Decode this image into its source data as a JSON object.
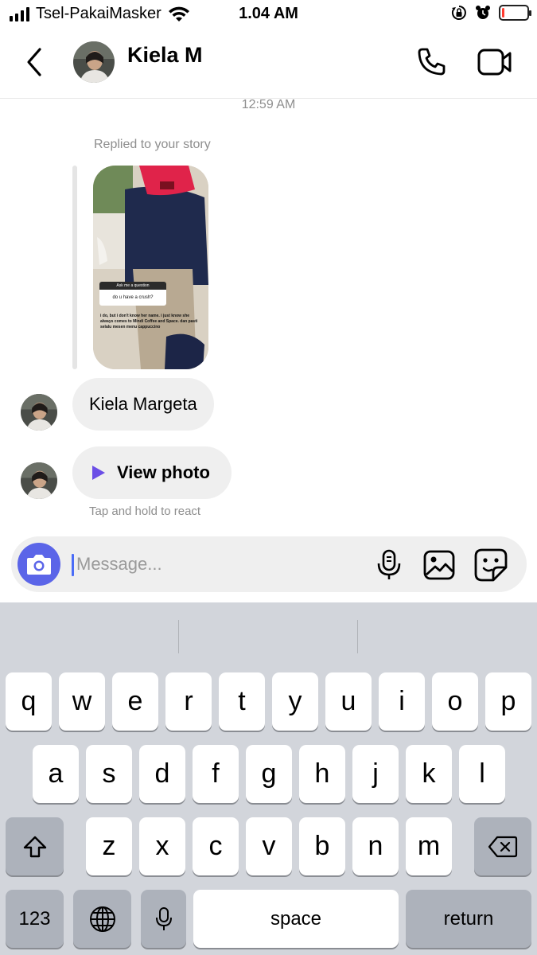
{
  "status_bar": {
    "carrier": "Tsel-PakaiMasker",
    "time": "1.04 AM",
    "battery_level": 0.1,
    "icons": [
      "signal-icon",
      "wifi-icon",
      "orientation-lock-icon",
      "alarm-icon",
      "battery-icon"
    ]
  },
  "header": {
    "contact_name": "Kiela M",
    "icons": [
      "back-chevron-icon",
      "phone-icon",
      "video-camera-icon"
    ]
  },
  "chat": {
    "timestamp": "12:59 AM",
    "replied_label": "Replied to your story",
    "story": {
      "sticker_title": "Ask me a question",
      "sticker_question": "do u have a crush?",
      "answer_text": "i do, but i don't know her name. i just know she always comes to Mindi Coffee and Space. dan pasti selalu mesen menu cappuccino",
      "cap_brand": "mason"
    },
    "messages": [
      {
        "type": "text",
        "text": "Kiela Margeta"
      },
      {
        "type": "photo",
        "text": "View photo"
      }
    ],
    "tap_hint": "Tap and hold to react"
  },
  "composer": {
    "placeholder": "Message...",
    "value": "",
    "icons": [
      "camera-icon",
      "microphone-icon",
      "gallery-icon",
      "sticker-icon"
    ],
    "accent_color": "#5b65e8"
  },
  "keyboard": {
    "row1": [
      "q",
      "w",
      "e",
      "r",
      "t",
      "y",
      "u",
      "i",
      "o",
      "p"
    ],
    "row2": [
      "a",
      "s",
      "d",
      "f",
      "g",
      "h",
      "j",
      "k",
      "l"
    ],
    "row3": [
      "z",
      "x",
      "c",
      "v",
      "b",
      "n",
      "m"
    ],
    "numbers_label": "123",
    "space_label": "space",
    "return_label": "return",
    "icons": [
      "shift-icon",
      "delete-icon",
      "globe-icon",
      "dictation-mic-icon"
    ]
  }
}
